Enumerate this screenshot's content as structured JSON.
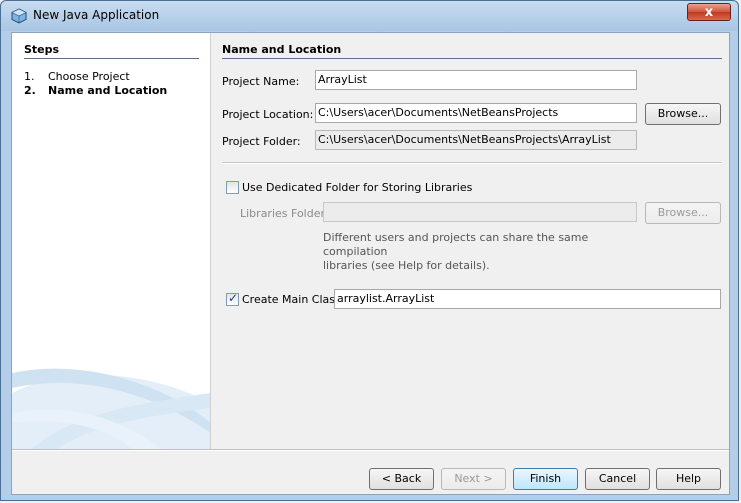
{
  "window": {
    "title": "New Java Application",
    "close_label": "x"
  },
  "steps": {
    "title": "Steps",
    "items": [
      {
        "num": "1.",
        "label": "Choose Project"
      },
      {
        "num": "2.",
        "label": "Name and Location"
      }
    ]
  },
  "main": {
    "title": "Name and Location",
    "project_name": {
      "label": "Project Name:",
      "value": "ArrayList"
    },
    "project_location": {
      "label": "Project Location:",
      "value": "C:\\Users\\acer\\Documents\\NetBeansProjects",
      "browse": "Browse..."
    },
    "project_folder": {
      "label": "Project Folder:",
      "value": "C:\\Users\\acer\\Documents\\NetBeansProjects\\ArrayList"
    },
    "dedicated_folder": {
      "label": "Use Dedicated Folder for Storing Libraries",
      "checked": false
    },
    "libraries_folder": {
      "label": "Libraries Folder:",
      "value": "",
      "browse": "Browse..."
    },
    "hint_line1": "Different users and projects can share the same compilation",
    "hint_line2": "libraries (see Help for details).",
    "main_class": {
      "label": "Create Main Class",
      "checked": true,
      "value": "arraylist.ArrayList"
    }
  },
  "buttons": {
    "back": "< Back",
    "next": "Next >",
    "finish": "Finish",
    "cancel": "Cancel",
    "help": "Help"
  },
  "colors": {
    "title_bar": "#b4cde8",
    "close_button": "#c0381f",
    "default_button": "#bee6fd"
  }
}
